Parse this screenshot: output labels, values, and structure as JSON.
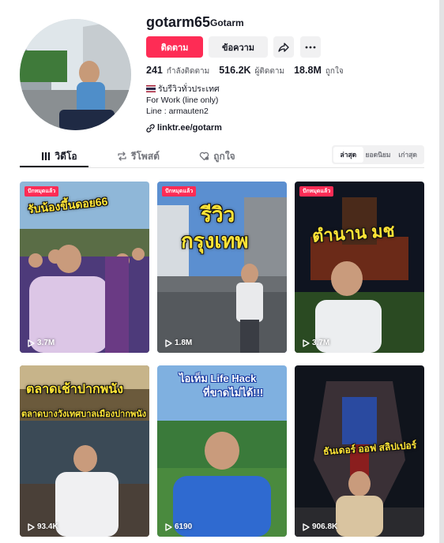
{
  "profile": {
    "username": "gotarm65",
    "nickname": "Gotarm",
    "follow_label": "ติดตาม",
    "message_label": "ข้อความ",
    "stats": [
      {
        "value": "241",
        "label": "กำลังติดตาม"
      },
      {
        "value": "516.2K",
        "label": "ผู้ติดตาม"
      },
      {
        "value": "18.8M",
        "label": "ถูกใจ"
      }
    ],
    "bio": [
      "รับรีวิวทั่วประเทศ",
      "For Work (line only)",
      "Line : armauten2"
    ],
    "link": "linktr.ee/gotarm"
  },
  "tabs": [
    {
      "label": "วิดีโอ",
      "icon": "grid-icon",
      "active": true
    },
    {
      "label": "รีโพสต์",
      "icon": "repost-icon",
      "active": false
    },
    {
      "label": "ถูกใจ",
      "icon": "heart-lock-icon",
      "active": false
    }
  ],
  "sort": [
    {
      "label": "ล่าสุด",
      "active": true
    },
    {
      "label": "ยอดนิยม",
      "active": false
    },
    {
      "label": "เก่าสุด",
      "active": false
    }
  ],
  "videos": [
    {
      "pinned": "ปักหมุดแล้ว",
      "views": "3.7M",
      "overlay": "รับน้องขึ้นดอย66",
      "colors": [
        "#8fb7d8",
        "#4d3a7a"
      ]
    },
    {
      "pinned": "ปักหมุดแล้ว",
      "views": "1.8M",
      "overlay": [
        "รีวิว",
        "กรุงเทพ"
      ],
      "colors": [
        "#5b8fd0",
        "#6a6e72"
      ]
    },
    {
      "pinned": "ปักหมุดแล้ว",
      "views": "3.7M",
      "overlay": "ตำนาน มช",
      "colors": [
        "#0f1420",
        "#6b2a18"
      ]
    },
    {
      "views": "93.4K",
      "overlay": [
        "ตลาดเช้าปากพนัง",
        "ตลาดบางวังเทศบาลเมืองปากพนัง"
      ],
      "colors": [
        "#6b5a3c",
        "#3b4a56"
      ]
    },
    {
      "views": "6190",
      "overlay": [
        "ไอเท็ม Life Hack",
        "ที่ขาดไม่ได้!!!"
      ],
      "colors": [
        "#7fb0e0",
        "#3a7a3a"
      ]
    },
    {
      "views": "906.8K",
      "overlay": "ธันเดอร์ ออฟ สลิปเปอร์",
      "colors": [
        "#10141c",
        "#3a3036"
      ]
    }
  ],
  "colors": {
    "accent": "#fe2c55",
    "text": "#161823",
    "muted": "#73757c"
  }
}
